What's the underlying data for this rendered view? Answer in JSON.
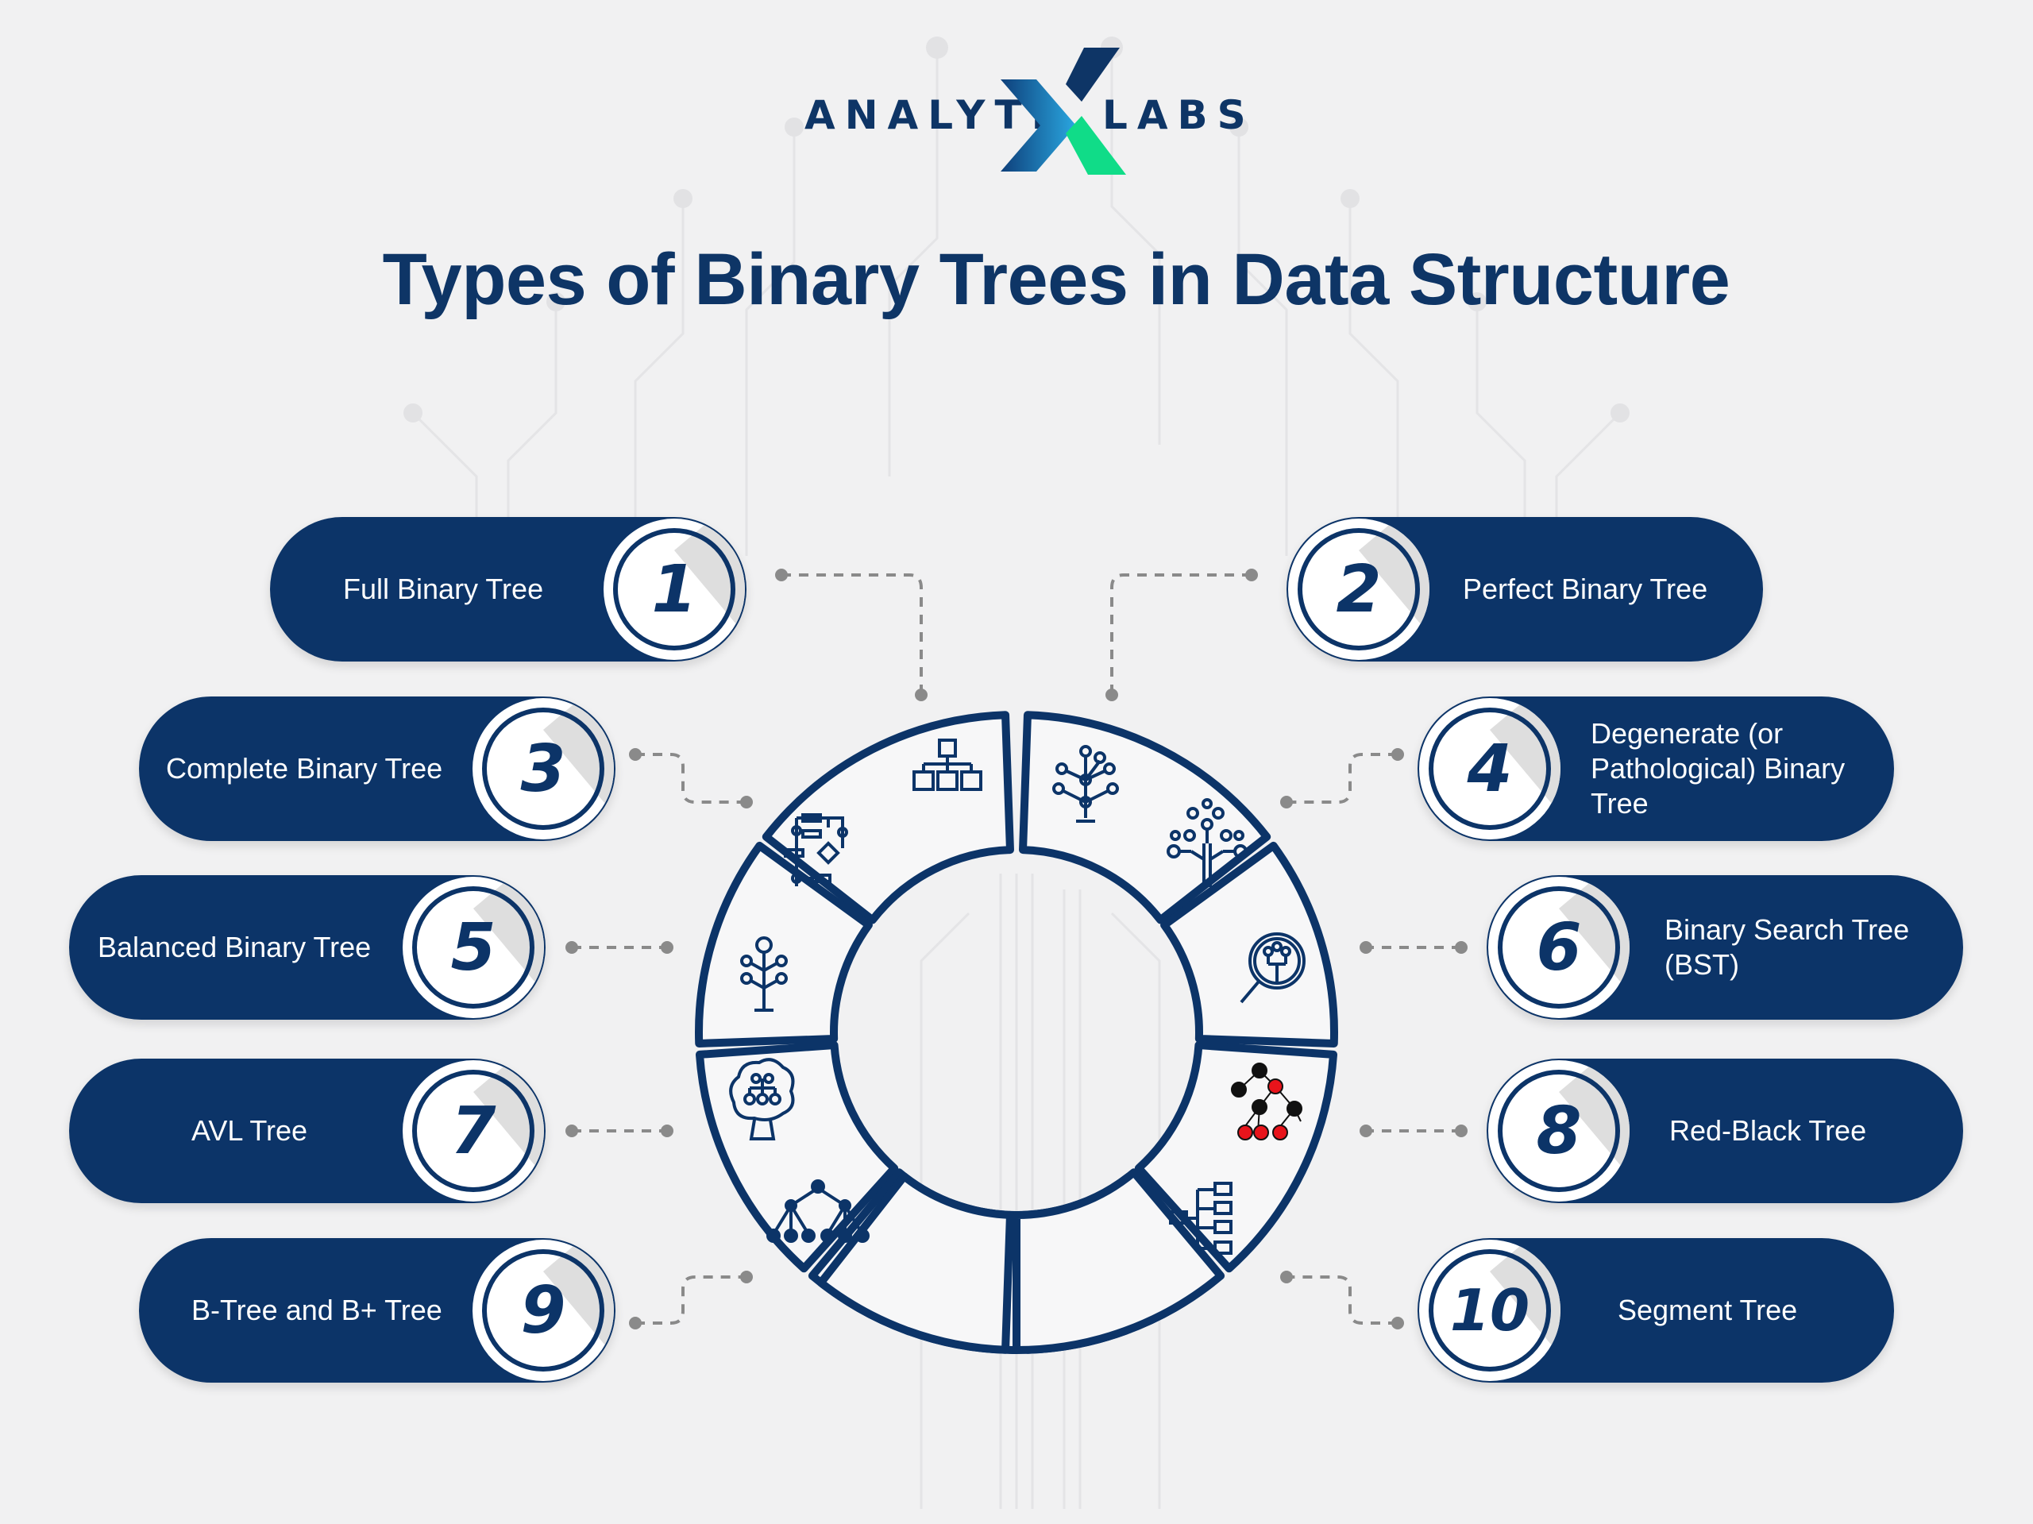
{
  "logo": {
    "left_text": "ANALYTI",
    "right_text": "LABS",
    "mark": "x-logo-icon",
    "colors": {
      "navy": "#0e3566",
      "blue_gradient_start": "#0e3f7a",
      "blue_gradient_end": "#2aa7e0",
      "green": "#10dc88"
    }
  },
  "title": "Types of Binary Trees in Data Structure",
  "colors": {
    "primary": "#0c3468",
    "background": "#f1f1f2",
    "segment_fill": "#f7f7f8",
    "red_node": "#e8141b",
    "black_node": "#111111",
    "connector": "#8a8a8a"
  },
  "items": [
    {
      "number": "1",
      "label": "Full Binary Tree",
      "icon": "org-chart-icon"
    },
    {
      "number": "2",
      "label": "Perfect Binary Tree",
      "icon": "node-tree-icon"
    },
    {
      "number": "3",
      "label": "Complete Binary Tree",
      "icon": "flowchart-icon"
    },
    {
      "number": "4",
      "label": "Degenerate (or Pathological) Binary Tree",
      "icon": "circuit-tree-icon"
    },
    {
      "number": "5",
      "label": "Balanced Binary Tree",
      "icon": "branch-tree-icon"
    },
    {
      "number": "6",
      "label": "Binary Search Tree (BST)",
      "icon": "magnifier-tree-icon"
    },
    {
      "number": "7",
      "label": "AVL Tree",
      "icon": "tree-hierarchy-icon"
    },
    {
      "number": "8",
      "label": "Red-Black Tree",
      "icon": "red-black-tree-icon"
    },
    {
      "number": "9",
      "label": "B-Tree and B+ Tree",
      "icon": "multiway-tree-icon"
    },
    {
      "number": "10",
      "label": "Segment Tree",
      "icon": "segment-bracket-icon"
    }
  ]
}
